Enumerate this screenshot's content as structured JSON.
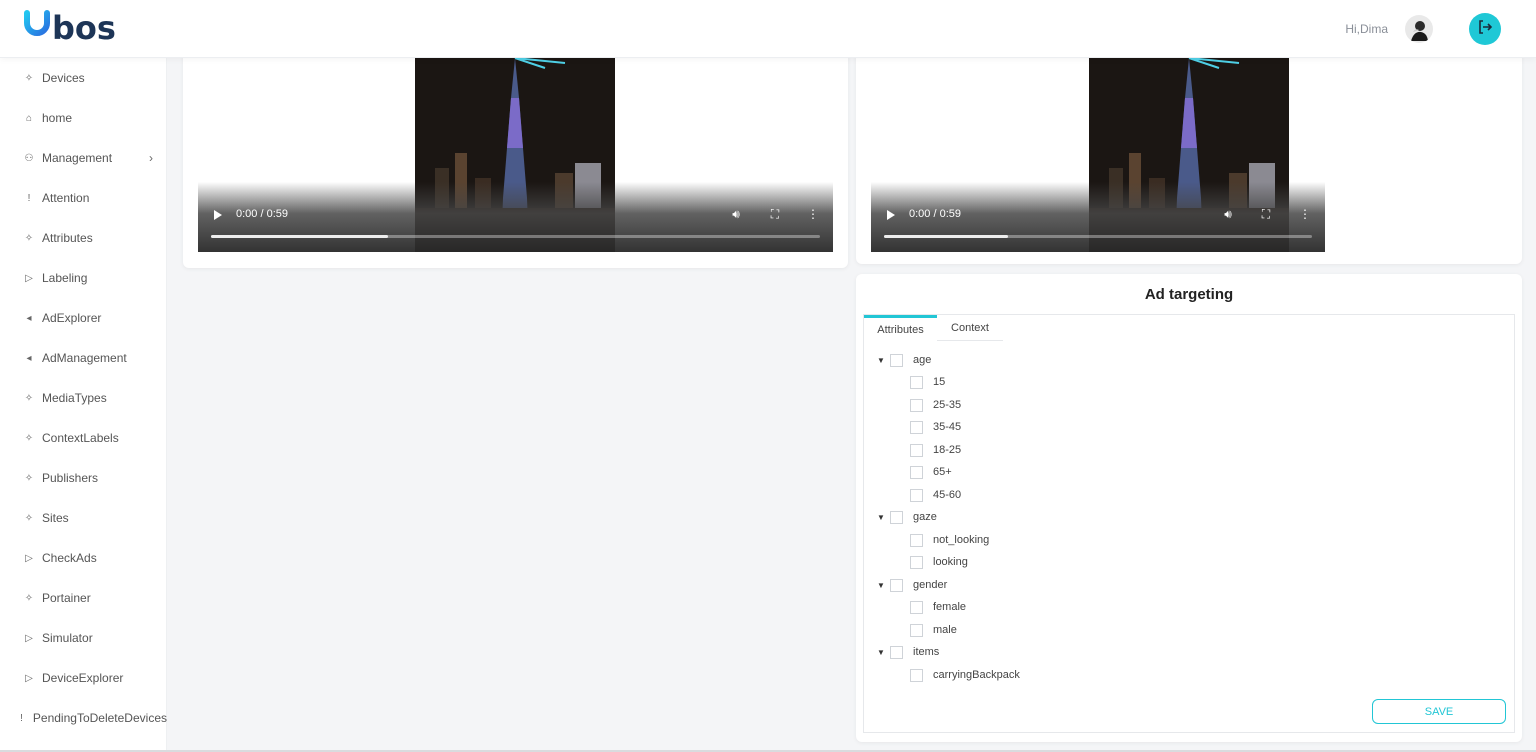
{
  "header": {
    "greeting": "Hi,Dima",
    "logo_text": "ubos",
    "brand_color": "#1fc8d6"
  },
  "sidebar": {
    "items": [
      {
        "label": "Devices",
        "icon": "sparkle-icon"
      },
      {
        "label": "home",
        "icon": "home-icon"
      },
      {
        "label": "Management",
        "icon": "users-icon",
        "has_submenu": true
      },
      {
        "label": "Attention",
        "icon": "exclamation-icon"
      },
      {
        "label": "Attributes",
        "icon": "sparkle-icon"
      },
      {
        "label": "Labeling",
        "icon": "tag-icon"
      },
      {
        "label": "AdExplorer",
        "icon": "megaphone-icon"
      },
      {
        "label": "AdManagement",
        "icon": "megaphone-icon"
      },
      {
        "label": "MediaTypes",
        "icon": "sparkle-icon"
      },
      {
        "label": "ContextLabels",
        "icon": "sparkle-icon"
      },
      {
        "label": "Publishers",
        "icon": "sparkle-icon"
      },
      {
        "label": "Sites",
        "icon": "sparkle-icon"
      },
      {
        "label": "CheckAds",
        "icon": "tag-icon"
      },
      {
        "label": "Portainer",
        "icon": "sparkle-icon"
      },
      {
        "label": "Simulator",
        "icon": "tag-icon"
      },
      {
        "label": "DeviceExplorer",
        "icon": "tag-icon"
      },
      {
        "label": "PendingToDeleteDevices",
        "icon": "exclamation-icon"
      }
    ]
  },
  "videos": [
    {
      "time": "0:00 / 0:59",
      "progress": 0.29
    },
    {
      "time": "0:00 / 0:59",
      "progress": 0.29
    }
  ],
  "ad_targeting": {
    "title": "Ad targeting",
    "tabs": [
      "Attributes",
      "Context"
    ],
    "active_tab": "Attributes",
    "tree": [
      {
        "label": "age",
        "children": [
          "15",
          "25-35",
          "35-45",
          "18-25",
          "65+",
          "45-60"
        ]
      },
      {
        "label": "gaze",
        "children": [
          "not_looking",
          "looking"
        ]
      },
      {
        "label": "gender",
        "children": [
          "female",
          "male"
        ]
      },
      {
        "label": "items",
        "children": [
          "carryingBackpack"
        ]
      }
    ],
    "save_label": "SAVE"
  }
}
